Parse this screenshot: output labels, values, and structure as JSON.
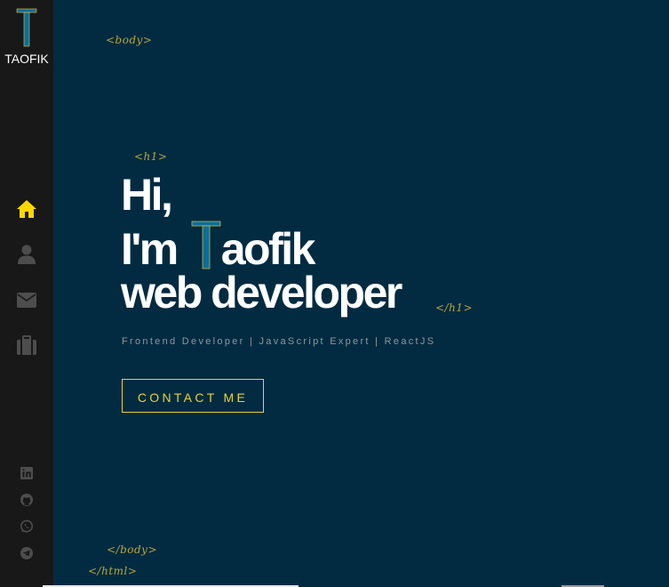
{
  "brand": {
    "logo_letter": "T",
    "name": "TAOFIK"
  },
  "nav": [
    {
      "label": "home",
      "icon": "home-icon",
      "active": true
    },
    {
      "label": "about",
      "icon": "user-icon",
      "active": false
    },
    {
      "label": "contact",
      "icon": "envelope-icon",
      "active": false
    },
    {
      "label": "portfolio",
      "icon": "briefcase-icon",
      "active": false
    }
  ],
  "social": [
    {
      "icon": "linkedin-icon"
    },
    {
      "icon": "github-icon"
    },
    {
      "icon": "whatsapp-icon"
    },
    {
      "icon": "telegram-icon"
    }
  ],
  "tags": {
    "body_open": "<body>",
    "h1_open": "<h1>",
    "h1_close": "</h1>",
    "body_close": "</body>",
    "html_close": "</html>"
  },
  "hero": {
    "line1": "Hi,",
    "line2_prefix": "I'm",
    "line2_letter": "T",
    "line2_suffix": "aofik",
    "line3": "web developer",
    "subtitle": "Frontend Developer | JavaScript Expert | ReactJS",
    "cta_label": "CONTACT ME"
  },
  "colors": {
    "background": "#022b41",
    "sidebar": "#181818",
    "accent": "#ffd700",
    "tag": "#b8a53a",
    "logo_blue": "#0d6e9a"
  }
}
